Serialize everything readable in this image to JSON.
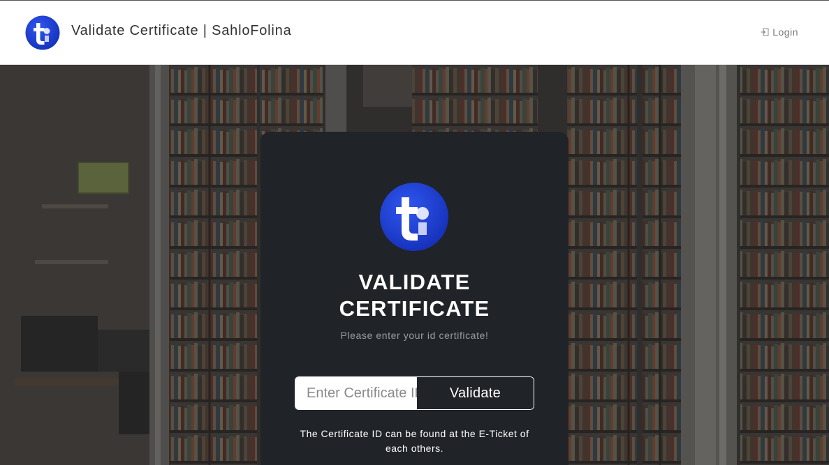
{
  "navbar": {
    "title": "Validate Certificate | SahloFolina",
    "login_label": "Login",
    "logo_icon": "brand-logo-icon",
    "login_icon": "login-icon"
  },
  "card": {
    "title_line1": "VALIDATE",
    "title_line2": "CERTIFICATE",
    "subtitle": "Please enter your id certificate!",
    "input_placeholder": "Enter Certificate ID",
    "input_value": "",
    "button_label": "Validate",
    "note": "The Certificate ID can be found at the E-Ticket of each others."
  },
  "colors": {
    "brand_blue": "#1f3fd6",
    "card_bg": "#202328",
    "navbar_bg": "#ffffff"
  }
}
